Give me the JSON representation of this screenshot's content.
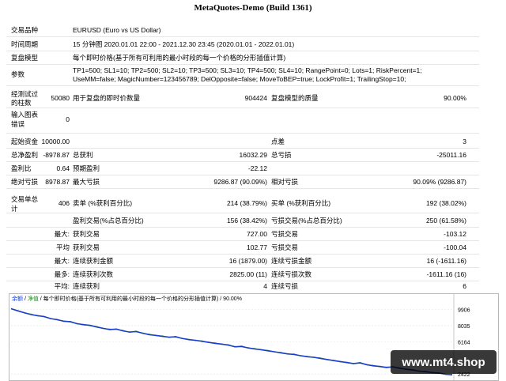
{
  "header": {
    "title": "MetaQuotes-Demo (Build 1361)"
  },
  "settings": {
    "symbol_label": "交易品种",
    "symbol_value": "EURUSD (Euro vs US Dollar)",
    "period_label": "时间周期",
    "period_value": "15 分钟图 2020.01.01 22:00 - 2021.12.30 23:45 (2020.01.01 - 2022.01.01)",
    "model_label": "复盘模型",
    "model_value": "每个即时价格(基于所有可利用的最小时段的每一个价格的分形插值计算)",
    "params_label": "参数",
    "params_line1": "TP1=500; SL1=10; TP2=500; SL2=10; TP3=500; SL3=10; TP4=500; SL4=10; RangePoint=0; Lots=1; RiskPercent=1;",
    "params_line2": "UseMM=false; MagicNumber=123456789; DelOpposite=false; MoveToBEP=true; LockProfit=1; TrailingStop=10;"
  },
  "bars_block": {
    "bars_label_l1": "经测试过",
    "bars_label_l2": "的柱数",
    "bars_value": "50080",
    "ticks_label": "用于复盘的即时价数量",
    "ticks_value": "904424",
    "quality_label": "复盘模型的质量",
    "quality_value": "90.00%",
    "errors_label_l1": "输入图表",
    "errors_label_l2": "错误",
    "errors_value": "0"
  },
  "results": {
    "deposit_label": "起始资金",
    "deposit_value": "10000.00",
    "spread_label": "点差",
    "spread_value": "3",
    "net_profit_label": "总净盈利",
    "net_profit_value": "-8978.87",
    "gross_profit_label": "总获利",
    "gross_profit_value": "16032.29",
    "gross_loss_label": "总亏损",
    "gross_loss_value": "-25011.16",
    "profit_factor_label": "盈利比",
    "profit_factor_value": "0.64",
    "expected_payoff_label": "预期盈利",
    "expected_payoff_value": "-22.12",
    "abs_dd_label": "绝对亏损",
    "abs_dd_value": "8978.87",
    "max_dd_label": "最大亏损",
    "max_dd_value": "9286.87 (90.09%)",
    "rel_dd_label": "相对亏损",
    "rel_dd_value": "90.09% (9286.87)",
    "total_trades_label_l1": "交易单总",
    "total_trades_label_l2": "计",
    "total_trades_value": "406",
    "short_label": "卖单 (%获利百分比)",
    "short_value": "214 (38.79%)",
    "long_label": "买单 (%获利百分比)",
    "long_value": "192 (38.02%)",
    "profit_trades_label": "盈利交易(%占总百分比)",
    "profit_trades_value": "156 (38.42%)",
    "loss_trades_label": "亏损交易(%占总百分比)",
    "loss_trades_value": "250 (61.58%)",
    "largest_label": "最大:",
    "largest_profit_label": "获利交易",
    "largest_profit_value": "727.00",
    "largest_loss_label": "亏损交易",
    "largest_loss_value": "-103.12",
    "average_label": "平均",
    "avg_profit_label": "获利交易",
    "avg_profit_value": "102.77",
    "avg_loss_label": "亏损交易",
    "avg_loss_value": "-100.04",
    "max_label": "最大:",
    "max_consec_wins_label": "连续获利金额",
    "max_consec_wins_value": "16 (1879.00)",
    "max_consec_losses_label": "连续亏损金额",
    "max_consec_losses_value": "16 (-1611.16)",
    "maximal_label": "最多:",
    "maximal_consec_profit_label": "连续获利次数",
    "maximal_consec_profit_value": "2825.00 (11)",
    "maximal_consec_loss_label": "连续亏损次数",
    "maximal_consec_loss_value": "-1611.16 (16)",
    "avg2_label": "平均:",
    "avg_consec_wins_label": "连续获利",
    "avg_consec_wins_value": "4",
    "avg_consec_losses_label": "连续亏损",
    "avg_consec_losses_value": "6"
  },
  "chart_legend": {
    "balance": "余额",
    "sep1": " / ",
    "equity": "净值",
    "rest": " / 每个即时价格(基于所有可利用的最小时段的每一个价格的分形插值计算) / 90.00%"
  },
  "chart_data": {
    "type": "line",
    "y_ticks": [
      "9906",
      "8035",
      "6164",
      "2422"
    ],
    "ylim": [
      1800,
      10600
    ],
    "series": [
      {
        "name": "余额",
        "color": "#1a3cc8",
        "values": [
          10000,
          9760,
          9540,
          9330,
          9200,
          9090,
          8860,
          8720,
          8560,
          8480,
          8270,
          8140,
          8070,
          7880,
          7720,
          7580,
          7640,
          7430,
          7290,
          7350,
          7160,
          6990,
          6910,
          6790,
          6700,
          6740,
          6560,
          6410,
          6340,
          6220,
          6100,
          5980,
          5900,
          5780,
          5590,
          5620,
          5460,
          5330,
          5250,
          5120,
          5010,
          4880,
          4760,
          4690,
          4550,
          4430,
          4370,
          4240,
          4110,
          3980,
          3870,
          3750,
          3640,
          3720,
          3510,
          3380,
          3300,
          3180,
          3270,
          3100,
          2980,
          2890,
          2760,
          2690,
          2600,
          2520,
          2400,
          2330
        ]
      },
      {
        "name": "净值",
        "color": "#2aa82a",
        "values": [
          10000,
          9800,
          9500,
          9380,
          9160,
          9130,
          8820,
          8780,
          8520,
          8540,
          8230,
          8200,
          8020,
          7940,
          7680,
          7640,
          7600,
          7490,
          7250,
          7410,
          7120,
          7050,
          6870,
          6850,
          6660,
          6800,
          6520,
          6470,
          6300,
          6280,
          6060,
          6040,
          5860,
          5840,
          5550,
          5680,
          5420,
          5390,
          5210,
          5180,
          4970,
          4940,
          4720,
          4750,
          4510,
          4490,
          4330,
          4300,
          4070,
          4040,
          3830,
          3810,
          3600,
          3780,
          3470,
          3440,
          3260,
          3240,
          3230,
          3160,
          2940,
          2950,
          2720,
          2750,
          2560,
          2580,
          2360,
          2390
        ]
      }
    ]
  },
  "watermark": {
    "text": "www.mt4.shop"
  }
}
